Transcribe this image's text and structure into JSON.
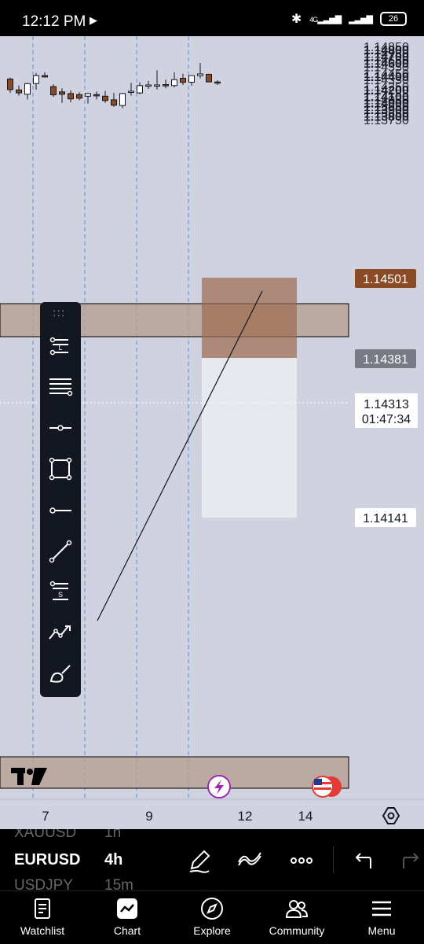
{
  "status_bar": {
    "time": "12:12 PM",
    "network": "4G",
    "battery": "26"
  },
  "chart": {
    "symbol": "EURUSD",
    "interval": "4h",
    "price_labels": [
      {
        "text": "1.14850",
        "bold": false
      },
      {
        "text": "1.14800",
        "bold": true
      },
      {
        "text": "1.14750",
        "bold": false
      },
      {
        "text": "1.14700",
        "bold": true
      },
      {
        "text": "1.14650",
        "bold": false
      },
      {
        "text": "1.14600",
        "bold": true
      },
      {
        "text": "1.14550",
        "bold": false
      },
      {
        "text": "1.14450",
        "bold": false
      },
      {
        "text": "1.14400",
        "bold": true
      },
      {
        "text": "1.14350",
        "bold": false
      },
      {
        "text": "1.14250",
        "bold": false
      },
      {
        "text": "1.14200",
        "bold": true
      },
      {
        "text": "1.14100",
        "bold": true
      },
      {
        "text": "1.14050",
        "bold": false
      },
      {
        "text": "1.14000",
        "bold": true
      },
      {
        "text": "1.13950",
        "bold": false
      },
      {
        "text": "1.13900",
        "bold": true
      },
      {
        "text": "1.13850",
        "bold": false
      },
      {
        "text": "1.13800",
        "bold": true
      },
      {
        "text": "1.13750",
        "bold": false
      }
    ],
    "tags": {
      "zone_top": "1.14501",
      "zone_mid": "1.14381",
      "last_price": "1.14313",
      "countdown": "01:47:34",
      "zone_bottom": "1.14141"
    },
    "time_labels": [
      "7",
      "9",
      "12",
      "14"
    ],
    "colors": {
      "background": "#d0d3df",
      "up_candle": "#ffffff",
      "down_candle": "#8b4a26",
      "zone": "#a98b7c",
      "gridline": "#5b8ae0"
    },
    "candles": [
      {
        "open": 1.1436,
        "high": 1.1438,
        "low": 1.1415,
        "close": 1.142
      },
      {
        "open": 1.14195,
        "high": 1.1426,
        "low": 1.1411,
        "close": 1.1415
      },
      {
        "open": 1.1413,
        "high": 1.143,
        "low": 1.1405,
        "close": 1.1429
      },
      {
        "open": 1.1429,
        "high": 1.1445,
        "low": 1.142,
        "close": 1.1441
      },
      {
        "open": 1.1441,
        "high": 1.1446,
        "low": 1.1438,
        "close": 1.1439
      },
      {
        "open": 1.14245,
        "high": 1.1428,
        "low": 1.1409,
        "close": 1.1412
      },
      {
        "open": 1.14165,
        "high": 1.1422,
        "low": 1.14,
        "close": 1.1413
      },
      {
        "open": 1.1414,
        "high": 1.1419,
        "low": 1.1401,
        "close": 1.1406
      },
      {
        "open": 1.14125,
        "high": 1.1416,
        "low": 1.1404,
        "close": 1.1407
      },
      {
        "open": 1.141,
        "high": 1.1415,
        "low": 1.1399,
        "close": 1.1414
      },
      {
        "open": 1.14125,
        "high": 1.1417,
        "low": 1.1405,
        "close": 1.14105
      },
      {
        "open": 1.141,
        "high": 1.1418,
        "low": 1.14,
        "close": 1.14035
      },
      {
        "open": 1.14045,
        "high": 1.1415,
        "low": 1.1394,
        "close": 1.13965
      },
      {
        "open": 1.1396,
        "high": 1.1415,
        "low": 1.1392,
        "close": 1.1414
      },
      {
        "open": 1.1416,
        "high": 1.143,
        "low": 1.1411,
        "close": 1.14175
      },
      {
        "open": 1.1415,
        "high": 1.1431,
        "low": 1.1413,
        "close": 1.1426
      },
      {
        "open": 1.14265,
        "high": 1.1433,
        "low": 1.1421,
        "close": 1.1427
      },
      {
        "open": 1.1427,
        "high": 1.1449,
        "low": 1.142,
        "close": 1.1427
      },
      {
        "open": 1.14275,
        "high": 1.1435,
        "low": 1.1422,
        "close": 1.14255
      },
      {
        "open": 1.1426,
        "high": 1.1446,
        "low": 1.1423,
        "close": 1.1435
      },
      {
        "open": 1.1437,
        "high": 1.1444,
        "low": 1.1427,
        "close": 1.1431
      },
      {
        "open": 1.1431,
        "high": 1.1441,
        "low": 1.1426,
        "close": 1.1441
      },
      {
        "open": 1.1441,
        "high": 1.146,
        "low": 1.1437,
        "close": 1.14435
      },
      {
        "open": 1.1443,
        "high": 1.1443,
        "low": 1.1431,
        "close": 1.14315
      },
      {
        "open": 1.14315,
        "high": 1.1434,
        "low": 1.1427,
        "close": 1.1431
      }
    ]
  },
  "drawing_tools": [
    {
      "name": "long-position-tool-icon"
    },
    {
      "name": "fib-retracement-tool-icon"
    },
    {
      "name": "horizontal-ray-tool-icon"
    },
    {
      "name": "rectangle-tool-icon"
    },
    {
      "name": "horizontal-line-tool-icon"
    },
    {
      "name": "trend-line-tool-icon"
    },
    {
      "name": "short-position-tool-icon"
    },
    {
      "name": "pattern-tool-icon"
    },
    {
      "name": "brush-tool-icon"
    }
  ],
  "watchlist_strip": {
    "prev_symbol": "XAUUSD",
    "prev_interval": "1h",
    "symbol": "EURUSD",
    "interval": "4h",
    "next_symbol": "USDJPY",
    "next_interval": "15m"
  },
  "nav": {
    "items": [
      {
        "label": "Watchlist"
      },
      {
        "label": "Chart"
      },
      {
        "label": "Explore"
      },
      {
        "label": "Community"
      },
      {
        "label": "Menu"
      }
    ]
  }
}
